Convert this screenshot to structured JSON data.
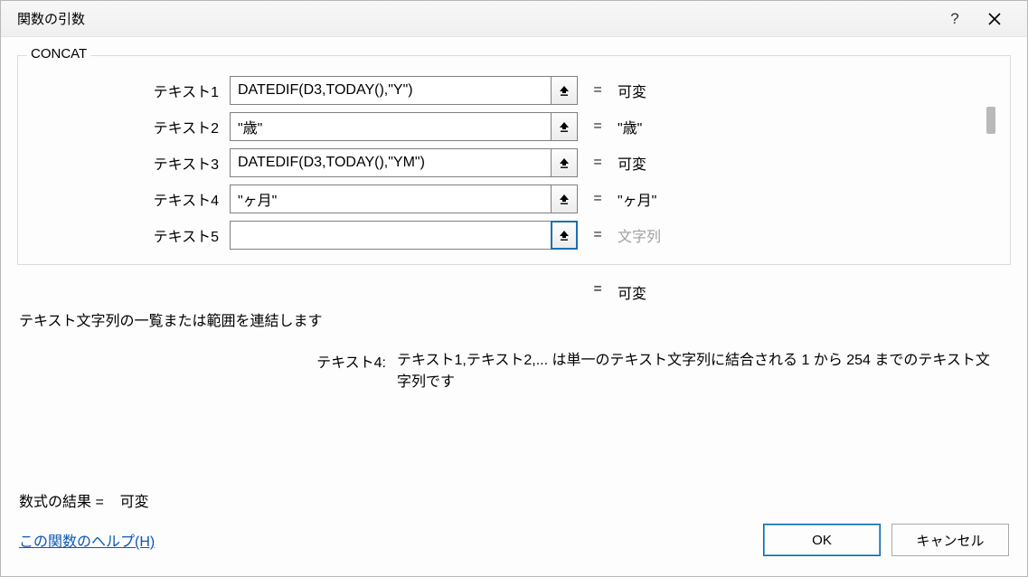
{
  "titlebar": {
    "title": "関数の引数",
    "help_symbol": "?",
    "close_label": "X"
  },
  "group": {
    "legend": "CONCAT"
  },
  "args": [
    {
      "label": "テキスト1",
      "value": "DATEDIF(D3,TODAY(),\"Y\")",
      "result": "可変",
      "placeholder": false,
      "active": false
    },
    {
      "label": "テキスト2",
      "value": "\"歳\"",
      "result": "\"歳\"",
      "placeholder": false,
      "active": false
    },
    {
      "label": "テキスト3",
      "value": "DATEDIF(D3,TODAY(),\"YM\")",
      "result": "可変",
      "placeholder": false,
      "active": false
    },
    {
      "label": "テキスト4",
      "value": "\"ヶ月\"",
      "result": "\"ヶ月\"",
      "placeholder": false,
      "active": false
    },
    {
      "label": "テキスト5",
      "value": "",
      "result": "文字列",
      "placeholder": true,
      "active": true
    }
  ],
  "eq_symbol": "=",
  "overall_result": "可変",
  "description1": "テキスト文字列の一覧または範囲を連結します",
  "description2_label": "テキスト4:",
  "description2_text": "テキスト1,テキスト2,...  は単一のテキスト文字列に結合される 1 から 254 までのテキスト文字列です",
  "formula_result_label": "数式の結果 =",
  "formula_result_value": "可変",
  "help_link": "この関数のヘルプ(H)",
  "buttons": {
    "ok": "OK",
    "cancel": "キャンセル"
  }
}
